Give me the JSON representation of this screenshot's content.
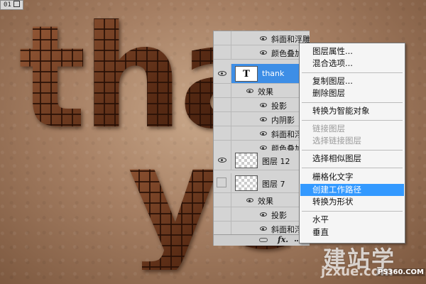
{
  "document_tab": {
    "label": "01"
  },
  "canvas": {
    "word1": "tha",
    "word2": "yo"
  },
  "layers_panel": {
    "top_effects": [
      "斜面和浮雕",
      "颜色叠加"
    ],
    "selected_layer": {
      "thumb": "T",
      "name": "thank"
    },
    "effects_label": "效果",
    "thank_effects": [
      "投影",
      "内阴影",
      "斜面和浮雕",
      "颜色叠加"
    ],
    "layer12": {
      "name": "图层 12"
    },
    "layer7": {
      "name": "图层 7"
    },
    "layer7_effects": [
      "投影",
      "斜面和浮雕"
    ],
    "fx_label": "fx."
  },
  "context_menu": {
    "items": [
      {
        "label": "图层属性...",
        "disabled": false
      },
      {
        "label": "混合选项...",
        "disabled": false
      },
      {
        "label": "复制图层...",
        "disabled": false
      },
      {
        "label": "删除图层",
        "disabled": false
      },
      {
        "label": "转换为智能对象",
        "disabled": false
      },
      {
        "label": "链接图层",
        "disabled": true
      },
      {
        "label": "选择链接图层",
        "disabled": true
      },
      {
        "label": "选择相似图层",
        "disabled": false
      },
      {
        "label": "栅格化文字",
        "disabled": false
      },
      {
        "label": "创建工作路径",
        "disabled": false,
        "highlighted": true
      },
      {
        "label": "转换为形状",
        "disabled": false
      },
      {
        "label": "水平",
        "disabled": false
      },
      {
        "label": "垂直",
        "disabled": false
      }
    ],
    "highlight_color": "#3399ff"
  },
  "watermark": {
    "brand": "建站学",
    "domain": "jzxue.com",
    "source": "PS360.COM"
  },
  "colors": {
    "selection": "#3d8ee6",
    "panel_bg": "#d4d4d4",
    "chocolate": "#5a2e18"
  }
}
